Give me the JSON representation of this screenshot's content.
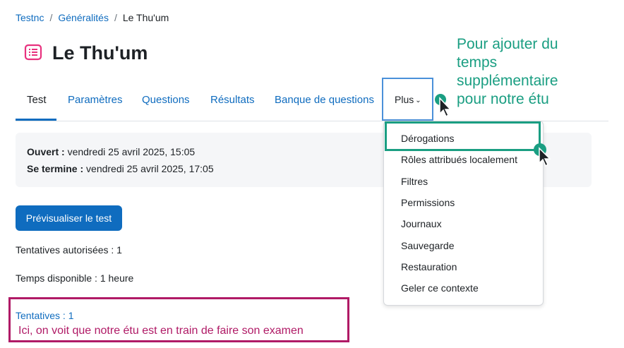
{
  "breadcrumb": {
    "items": [
      "Testnc",
      "Généralités"
    ],
    "separator": "/",
    "current": "Le Thu'um"
  },
  "page": {
    "title": "Le Thu'um",
    "icon": "quiz-icon"
  },
  "tabs": [
    {
      "label": "Test",
      "active": true
    },
    {
      "label": "Paramètres"
    },
    {
      "label": "Questions"
    },
    {
      "label": "Résultats"
    },
    {
      "label": "Banque de questions"
    },
    {
      "label": "Plus"
    }
  ],
  "info": {
    "open_label": "Ouvert :",
    "open_value": "vendredi 25 avril 2025, 15:05",
    "close_label": "Se termine :",
    "close_value": "vendredi 25 avril 2025, 17:05"
  },
  "preview_button": "Prévisualiser le test",
  "attempts_allowed": "Tentatives autorisées : 1",
  "time_available": "Temps disponible : 1 heure",
  "attempts_link": "Tentatives : 1",
  "dropdown": {
    "items": [
      "Dérogations",
      "Rôles attribués localement",
      "Filtres",
      "Permissions",
      "Journaux",
      "Sauvegarde",
      "Restauration",
      "Geler ce contexte"
    ]
  },
  "annotations": {
    "teal_lines": [
      "Pour ajouter du",
      "temps",
      "supplémentaire",
      "pour notre étu"
    ],
    "pink_text": "Ici, on voit que notre étu est en train de faire son examen",
    "teal_color": "#1a9e82",
    "pink_color": "#b01a66",
    "blue_box_color": "#4a90d9"
  },
  "colors": {
    "link": "#0f6cbf",
    "primary_button": "#0f6cbf",
    "title_icon": "#e8317e"
  }
}
